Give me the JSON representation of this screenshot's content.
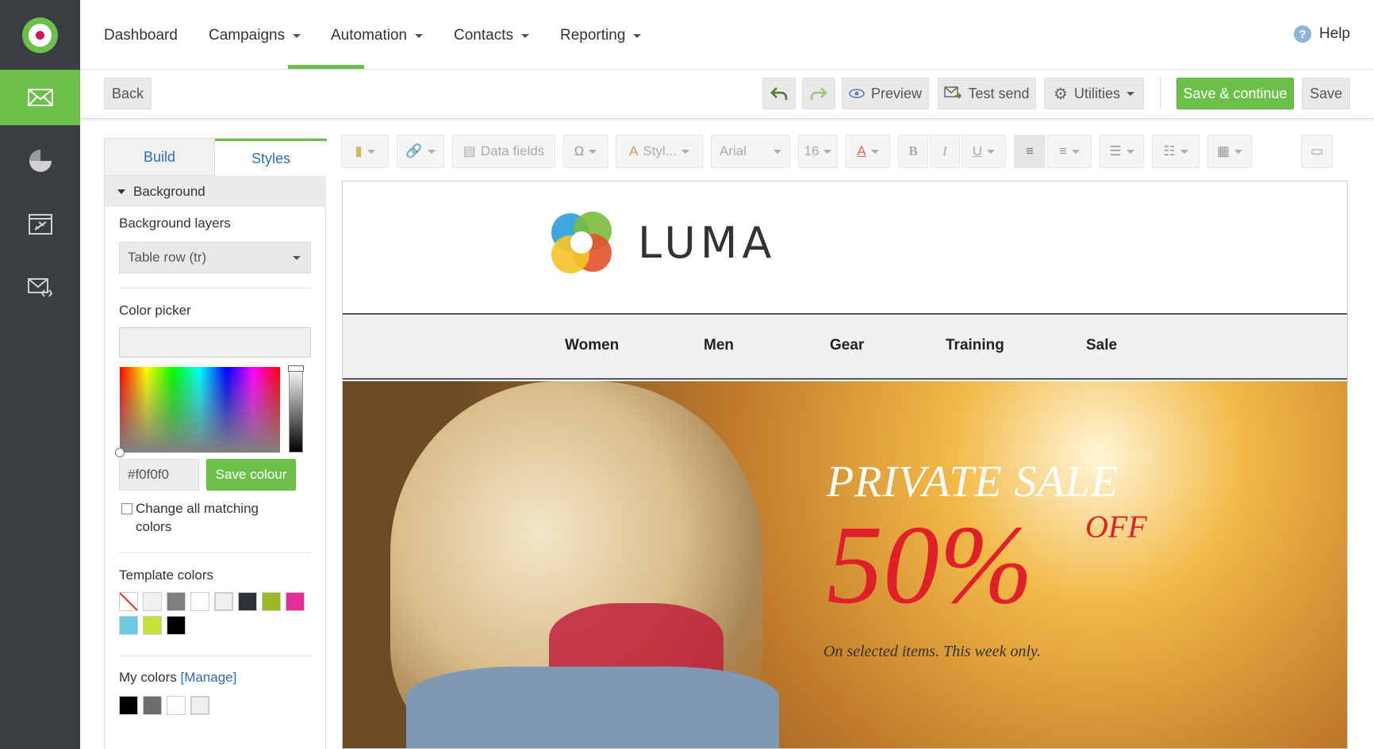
{
  "nav": {
    "dashboard": "Dashboard",
    "campaigns": "Campaigns",
    "automation": "Automation",
    "contacts": "Contacts",
    "reporting": "Reporting",
    "help": "Help"
  },
  "toolbar": {
    "back": "Back",
    "preview": "Preview",
    "test_send": "Test send",
    "utilities": "Utilities",
    "save_continue": "Save & continue",
    "save": "Save"
  },
  "panel": {
    "tab_build": "Build",
    "tab_styles": "Styles",
    "section": "Background",
    "bg_layers_label": "Background layers",
    "bg_layers_value": "Table row (tr)",
    "color_picker_label": "Color picker",
    "hex_value": "#f0f0f0",
    "save_colour": "Save colour",
    "change_all_line1": "Change all matching",
    "change_all_line2": "colors",
    "template_colors_label": "Template colors",
    "template_colors": [
      "#f0f0f0",
      "#808080",
      "#ffffff",
      "#f0f0f0",
      "#2f3238",
      "#9bb826",
      "#e62e9b",
      "#6ccbe0",
      "#c4e33a",
      "#000000"
    ],
    "my_colors_label": "My colors",
    "manage_link": "[Manage]",
    "my_colors": [
      "#000000",
      "#6d6d6d",
      "#ffffff",
      "#f0f0f0"
    ]
  },
  "editor_toolbar": {
    "data_fields": "Data fields",
    "styles": "Styl...",
    "font": "Arial",
    "size": "16",
    "bold": "B",
    "italic": "I",
    "underline": "U"
  },
  "email": {
    "brand": "LUMA",
    "menu": [
      "Women",
      "Men",
      "Gear",
      "Training",
      "Sale"
    ],
    "hero_title": "PRIVATE SALE",
    "hero_percent": "50%",
    "hero_off": "OFF",
    "hero_sub": "On selected items. This week only."
  },
  "colors": {
    "accent": "#6cc04a",
    "sidebar": "#3a3d41",
    "link": "#2f6db5"
  }
}
